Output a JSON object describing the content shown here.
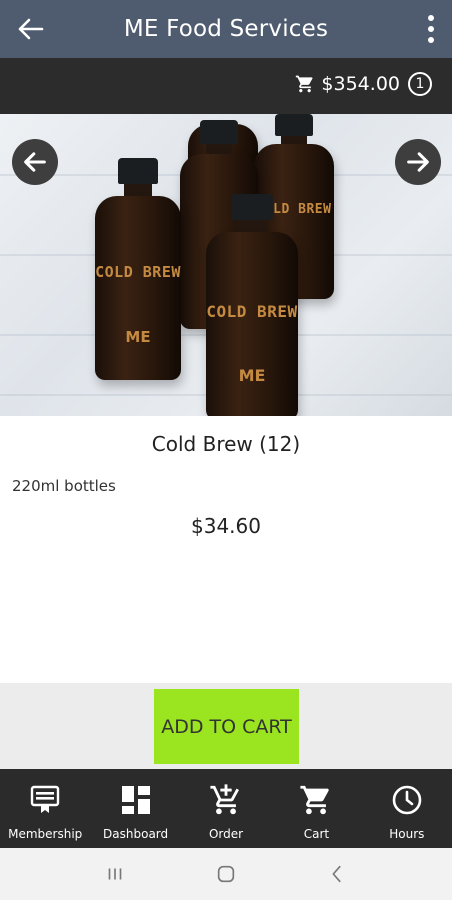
{
  "app": {
    "title": "ME Food Services"
  },
  "cart_bar": {
    "total": "$354.00",
    "count": "1"
  },
  "product": {
    "name": "Cold Brew (12)",
    "description": "220ml bottles",
    "price": "$34.60",
    "image_label_text": "COLD BREW",
    "image_logo_text": "ME"
  },
  "actions": {
    "add_to_cart": "ADD TO CART"
  },
  "bottom_nav": {
    "items": [
      {
        "label": "Membership",
        "icon": "membership-icon"
      },
      {
        "label": "Dashboard",
        "icon": "dashboard-icon"
      },
      {
        "label": "Order",
        "icon": "add-to-cart-icon"
      },
      {
        "label": "Cart",
        "icon": "cart-icon"
      },
      {
        "label": "Hours",
        "icon": "clock-icon"
      }
    ]
  },
  "colors": {
    "appbar": "#4f5b6e",
    "cartbar": "#2c2c2c",
    "add_button": "#9ae51f",
    "bottom_nav": "#2b2b2b"
  }
}
